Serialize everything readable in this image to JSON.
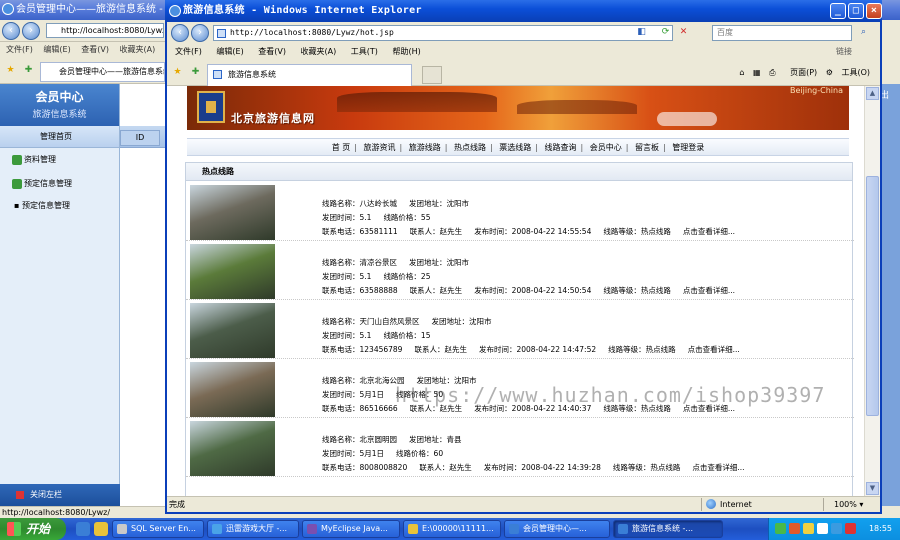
{
  "bg_window": {
    "title": "会员管理中心——旅游信息系统 - Windows Internet Explorer",
    "address": "http://localhost:8080/Lywz/",
    "menu": [
      "文件(F)",
      "编辑(E)",
      "查看(V)",
      "收藏夹(A)"
    ],
    "tab": "会员管理中心——旅游信息系统",
    "sidebar": {
      "title": "会员中心",
      "subtitle": "旅游信息系统",
      "home": "管理首页",
      "items": [
        "资料管理",
        "预定信息管理"
      ],
      "sub": "预定信息管理",
      "footer": "关闭左栏"
    },
    "table_header_id": "ID",
    "status": "http://localhost:8080/Lywz/",
    "right_label": "出"
  },
  "window": {
    "title": "旅游信息系统 - Windows Internet Explorer",
    "address": "http://localhost:8080/Lywz/hot.jsp",
    "search_placeholder": "百度",
    "menu": [
      "文件(F)",
      "编辑(E)",
      "查看(V)",
      "收藏夹(A)",
      "工具(T)",
      "帮助(H)"
    ],
    "links_label": "链接",
    "tab": "旅游信息系统",
    "tools": [
      "页面(P)",
      "工具(O)"
    ],
    "status_text": "完成",
    "zone": "Internet",
    "zoom": "100%"
  },
  "page": {
    "banner_title": "北京旅游信息网",
    "banner_tag": "Beijing-China",
    "nav": [
      "首 页",
      "旅游资讯",
      "旅游线路",
      "热点线路",
      "票选线路",
      "线路查询",
      "会员中心",
      "留言板",
      "管理登录"
    ],
    "section_title": "热点线路",
    "routes": [
      {
        "name": "线路名称：八达岭长城",
        "from": "发团地址：沈阳市",
        "time": "发团时间：5.1",
        "price": "线路价格：55",
        "phone": "联系电话：63581111",
        "contact": "联系人：赵先生",
        "published": "发布时间：2008-04-22 14:55:54",
        "level": "线路等级：热点线路",
        "more": "点击查看详细..."
      },
      {
        "name": "线路名称：清凉谷景区",
        "from": "发团地址：沈阳市",
        "time": "发团时间：5.1",
        "price": "线路价格：25",
        "phone": "联系电话：63588888",
        "contact": "联系人：赵先生",
        "published": "发布时间：2008-04-22 14:50:54",
        "level": "线路等级：热点线路",
        "more": "点击查看详细..."
      },
      {
        "name": "线路名称：天门山自然风景区",
        "from": "发团地址：沈阳市",
        "time": "发团时间：5.1",
        "price": "线路价格：15",
        "phone": "联系电话：123456789",
        "contact": "联系人：赵先生",
        "published": "发布时间：2008-04-22 14:47:52",
        "level": "线路等级：热点线路",
        "more": "点击查看详细..."
      },
      {
        "name": "线路名称：北京北海公园",
        "from": "发团地址：沈阳市",
        "time": "发团时间：5月1日",
        "price": "线路价格：50",
        "phone": "联系电话：86516666",
        "contact": "联系人：赵先生",
        "published": "发布时间：2008-04-22 14:40:37",
        "level": "线路等级：热点线路",
        "more": "点击查看详细..."
      },
      {
        "name": "线路名称：北京圆明园",
        "from": "发团地址：青县",
        "time": "发团时间：5月1日",
        "price": "线路价格：60",
        "phone": "联系电话：8008008820",
        "contact": "联系人：赵先生",
        "published": "发布时间：2008-04-22 14:39:28",
        "level": "线路等级：热点线路",
        "more": "点击查看详细..."
      }
    ],
    "route_image_colors": [
      "#6d6a5e",
      "#5b7b3a",
      "#4c5d4a",
      "#7a6a55",
      "#4f6a45"
    ],
    "watermark": "https://www.huzhan.com/ishop39397"
  },
  "taskbar": {
    "start": "开始",
    "buttons": [
      "SQL Server En...",
      "迅雷游戏大厅 -...",
      "MyEclipse Java...",
      "E:\\00000\\11111...",
      "会员管理中心—...",
      "旅游信息系统 -..."
    ],
    "clock": "18:55"
  }
}
